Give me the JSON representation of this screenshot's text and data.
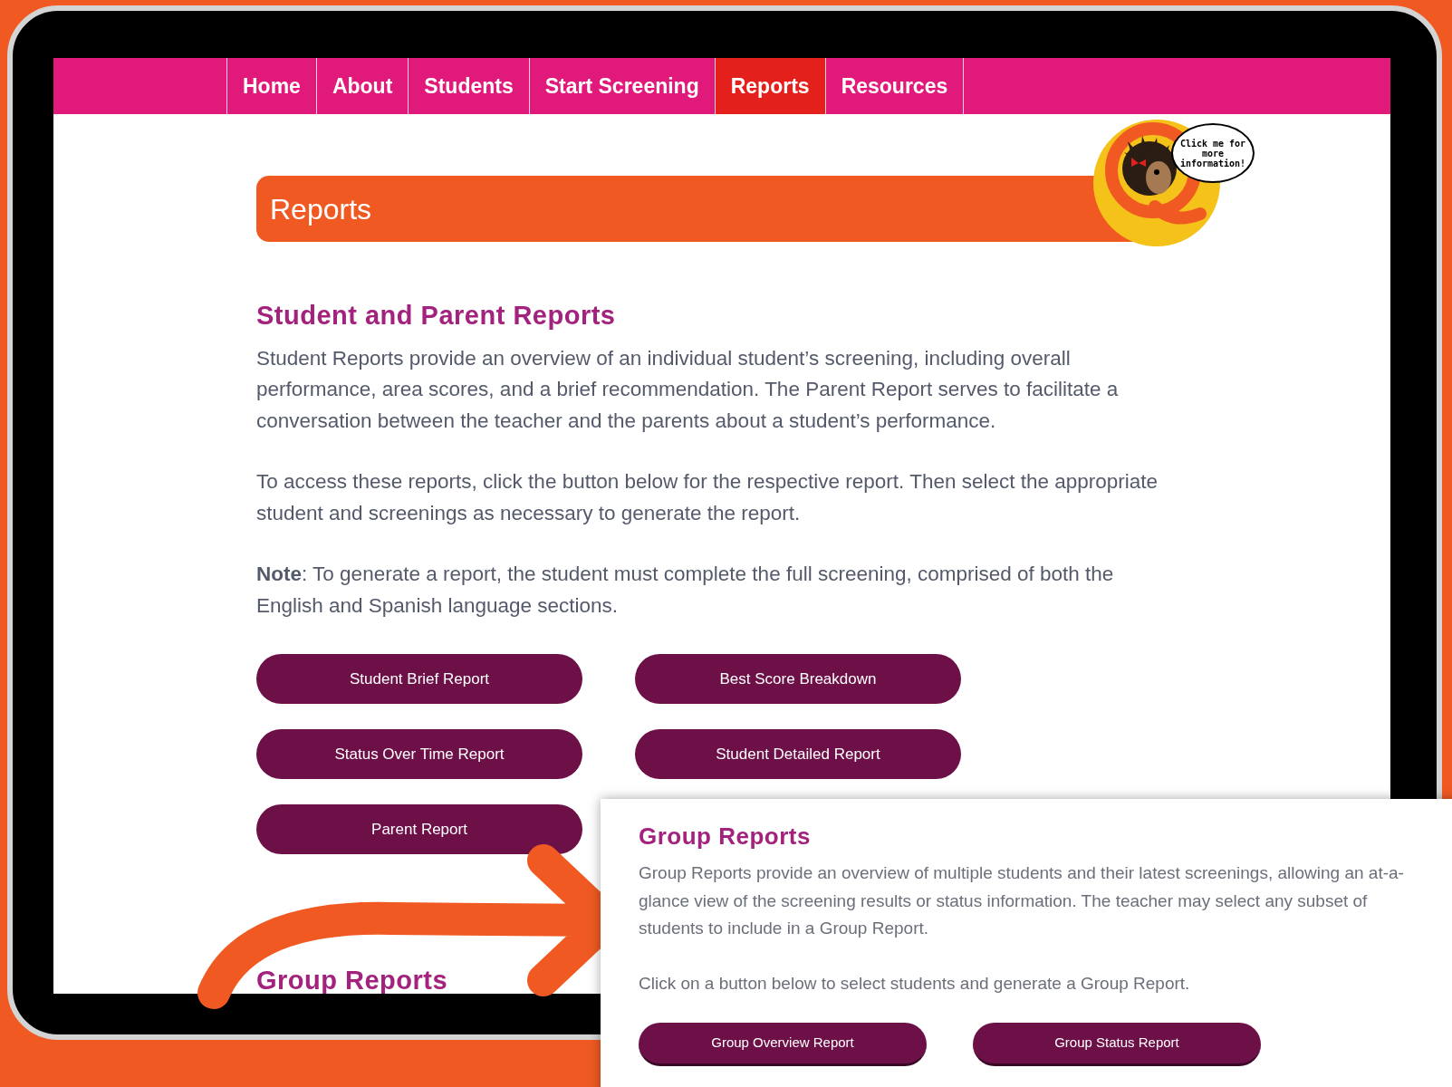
{
  "nav": {
    "items": [
      {
        "label": "Home",
        "selected": false
      },
      {
        "label": "About",
        "selected": false
      },
      {
        "label": "Students",
        "selected": false
      },
      {
        "label": "Start Screening",
        "selected": false
      },
      {
        "label": "Reports",
        "selected": true
      },
      {
        "label": "Resources",
        "selected": false
      }
    ]
  },
  "mascot": {
    "bubble": "Click me for more information!"
  },
  "page_title": "Reports",
  "student_section": {
    "heading": "Student and Parent Reports",
    "paragraphs": [
      "Student Reports provide an overview of an individual student’s screening, including overall performance, area scores, and a brief recommendation. The Parent Report serves to facilitate a conversation between the teacher and the parents about a student’s performance.",
      "To access these reports, click the button below for the respective report. Then select the appropriate student and screenings as necessary to generate the report.",
      "**Note**: To generate a report, the student must complete the full screening, comprised of both the English and Spanish language sections."
    ],
    "buttons": [
      "Student Brief Report",
      "Best Score Breakdown",
      "Status Over Time Report",
      "Student Detailed Report",
      "Parent Report"
    ]
  },
  "group_heading": "Group Reports",
  "callout": {
    "heading": "Group Reports",
    "paragraphs": [
      "Group Reports provide an overview of multiple students and their latest screenings, allowing an at-a-glance view of the screening results or status information. The teacher may select any subset of students to include in a Group Report.",
      "Click on a button below to select students and generate a Group Report."
    ],
    "buttons": [
      "Group Overview Report",
      "Group Status Report"
    ]
  }
}
